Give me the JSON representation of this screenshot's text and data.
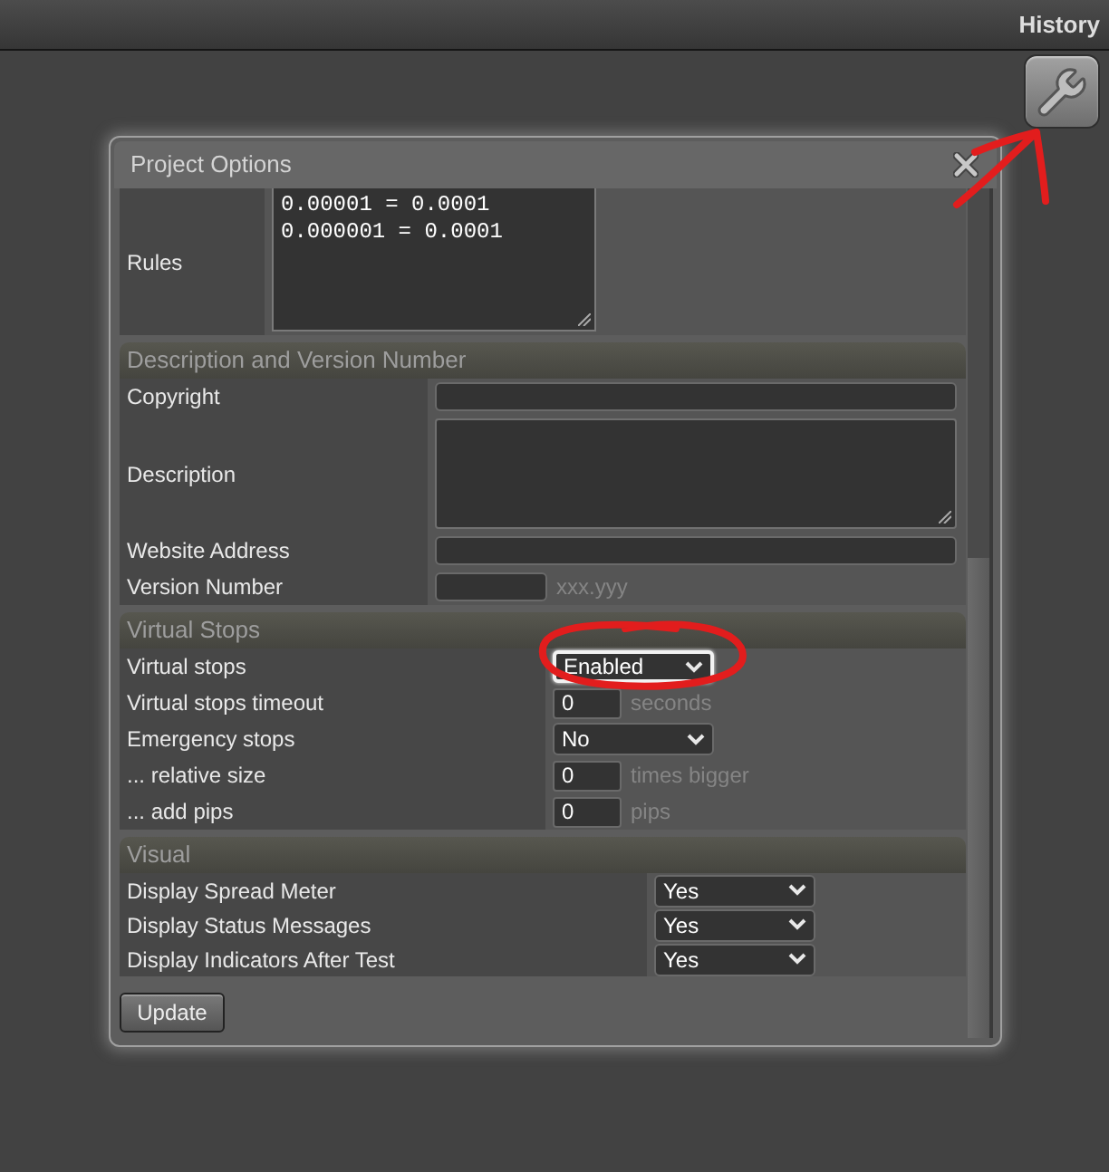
{
  "top_bar": {
    "title": "History"
  },
  "settings_button": {
    "arrow_annotation": true
  },
  "dialog": {
    "title": "Project Options",
    "sections": [
      {
        "rows": [
          {
            "label": "Rules",
            "kind": "code_area",
            "lines": [
              "0.00001 = 0.0001",
              "0.000001 = 0.0001"
            ]
          }
        ]
      },
      {
        "title": "Description and Version Number",
        "rows": [
          {
            "label": "Copyright",
            "kind": "input"
          },
          {
            "label": "Description",
            "kind": "textarea"
          },
          {
            "label": "Website Address",
            "kind": "input"
          },
          {
            "label": "Version Number",
            "kind": "short_input",
            "suffix": "xxx.yyy"
          }
        ]
      },
      {
        "title": "Virtual Stops",
        "rows": [
          {
            "label": "Virtual stops",
            "kind": "select",
            "value": "Enabled",
            "focused": true,
            "circled": true
          },
          {
            "label": "Virtual stops timeout",
            "kind": "number",
            "value": "0",
            "suffix": "seconds"
          },
          {
            "label": "Emergency stops",
            "kind": "select",
            "value": "No",
            "focused": false,
            "circled": false
          },
          {
            "label": "... relative size",
            "kind": "number",
            "value": "0",
            "suffix": "times bigger"
          },
          {
            "label": "... add pips",
            "kind": "number",
            "value": "0",
            "suffix": "pips"
          }
        ]
      },
      {
        "title": "Visual",
        "rows": [
          {
            "label": "Display Spread Meter",
            "kind": "select",
            "value": "Yes",
            "focused": false,
            "circled": false
          },
          {
            "label": "Display Status Messages",
            "kind": "select",
            "value": "Yes",
            "focused": false,
            "circled": false
          },
          {
            "label": "Display Indicators After Test",
            "kind": "select",
            "value": "Yes",
            "focused": false,
            "circled": false
          }
        ]
      }
    ],
    "button": "Update"
  }
}
